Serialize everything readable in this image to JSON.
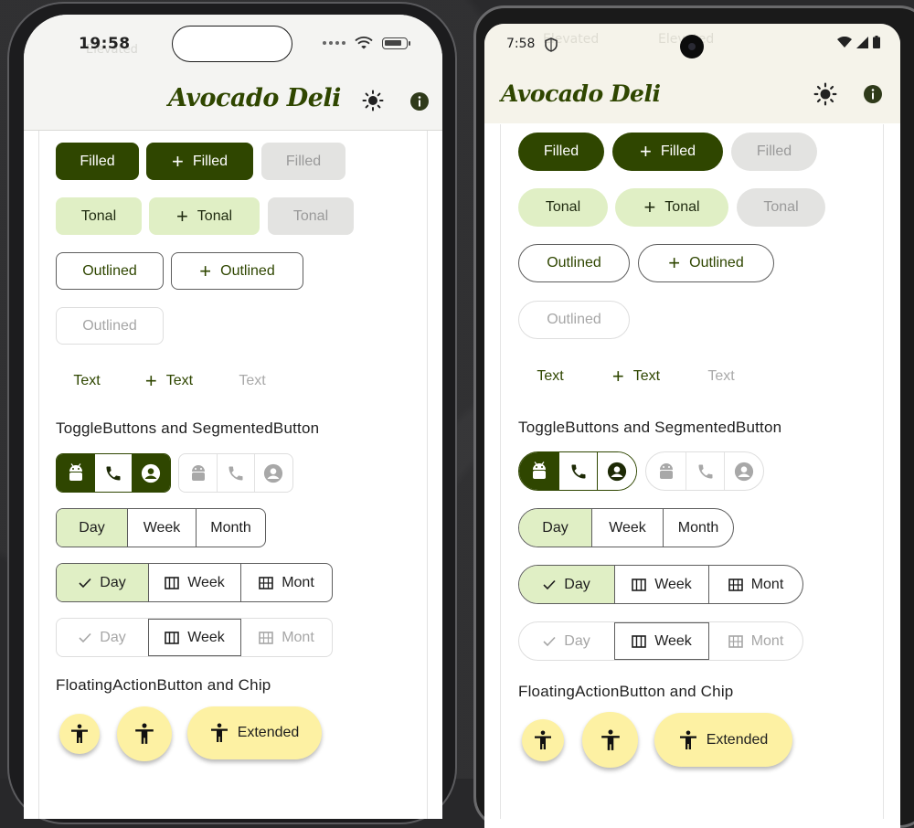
{
  "ios": {
    "status": {
      "time": "19:58",
      "ghost_text": "Elevated"
    },
    "app_title": "Avocado Deli",
    "buttons": {
      "filled": "Filled",
      "filled_icon": "Filled",
      "filled_disabled": "Filled",
      "tonal": "Tonal",
      "tonal_icon": "Tonal",
      "tonal_disabled": "Tonal",
      "outlined": "Outlined",
      "outlined_icon": "Outlined",
      "outlined_disabled": "Outlined",
      "text": "Text",
      "text_icon": "Text",
      "text_disabled": "Text"
    },
    "section_toggle": "ToggleButtons and SegmentedButton",
    "toggle_enabled": [
      "android-icon",
      "phone-icon",
      "account-icon"
    ],
    "toggle_disabled": [
      "android-icon",
      "phone-icon",
      "account-icon"
    ],
    "segmented1": [
      "Day",
      "Week",
      "Month"
    ],
    "segmented2": [
      "Day",
      "Week",
      "Mont"
    ],
    "segmented3": [
      "Day",
      "Week",
      "Mont"
    ],
    "section_fab": "FloatingActionButton and Chip",
    "fab_extended": "Extended"
  },
  "android": {
    "status": {
      "time": "7:58",
      "ghost1": "Elevated",
      "ghost2": "Elevated"
    },
    "app_title": "Avocado Deli",
    "buttons": {
      "filled": "Filled",
      "filled_icon": "Filled",
      "filled_disabled": "Filled",
      "tonal": "Tonal",
      "tonal_icon": "Tonal",
      "tonal_disabled": "Tonal",
      "outlined": "Outlined",
      "outlined_icon": "Outlined",
      "outlined_disabled": "Outlined",
      "text": "Text",
      "text_icon": "Text",
      "text_disabled": "Text"
    },
    "section_toggle": "ToggleButtons and SegmentedButton",
    "segmented1": [
      "Day",
      "Week",
      "Month"
    ],
    "segmented2": [
      "Day",
      "Week",
      "Mont"
    ],
    "segmented3": [
      "Day",
      "Week",
      "Mont"
    ],
    "section_fab": "FloatingActionButton and Chip",
    "fab_extended": "Extended"
  },
  "colors": {
    "primary": "#2f4600",
    "tonal": "#e0efc5",
    "fab": "#fdf1a3",
    "appbar_ios": "#f4f4f2",
    "appbar_android": "#f5f3ea"
  }
}
